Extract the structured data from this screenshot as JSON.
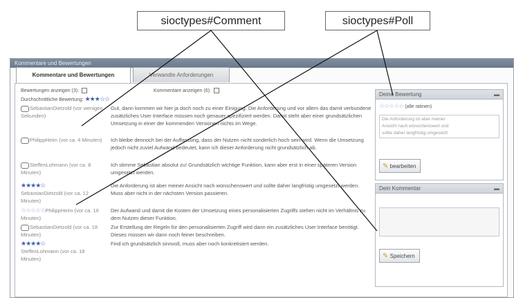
{
  "callouts": {
    "comment": "sioctypes#Comment",
    "poll": "sioctypes#Poll"
  },
  "window": {
    "title": "Kommentare und Bewertungen",
    "tabs": [
      {
        "label": "Kommentare und Bewertungen"
      },
      {
        "label": "Verwandte Anforderungen"
      }
    ]
  },
  "filters": {
    "show_ratings": "Bewertungen anzeigen (3):",
    "average_rating": "Durchschnittliche Bewertung:",
    "show_comments": "Kommentare anzeigen (6):"
  },
  "entries": [
    {
      "author": "SebastianDietzold",
      "time": "(vor wenigen Sekunden)",
      "text": "Gut, dann kommen wir hier ja doch noch zu einer Einigung. Die Anforderung und vor allem das damit verbundene zusätzliches User Interface müssen noch genauer spezifiziert werden. Damit steht aber einer grundsätzlichen Umsetzung in einer der kommenden Versionen nichts im Wege."
    },
    {
      "author": "PhilippHeim",
      "time": "(vor ca. 4 Minuten)",
      "text": "Ich bleibe dennoch bei der Auffassung, dass der Nutzen nicht sonderlich hoch sein wird. Wenn die Umsetzung jedoch nicht zuviel Aufwand bedeutet, kann ich dieser Anforderung nicht grundsätzlich ab."
    },
    {
      "author": "SteffenLohmann",
      "time": "(vor ca. 8 Minuten)",
      "text": "Ich stimme Sebastian absolut zu! Grundsätzlich wichtige Funktion, kann aber erst in einer späteren Version umgesetzt werden."
    },
    {
      "author": "SebastianDietzold",
      "time": "(vor ca. 12 Minuten)",
      "text": "Die Anforderung ist aber meiner Ansicht nach wünschenswert und sollte daher langfristig umgesetzt werden. Muss aber nicht in der nächsten Version passieren."
    },
    {
      "author": "PhilippHeim",
      "time": "(vor ca. 16 Minuten)",
      "text": "Der Aufwand und damit die Kosten der Umsetzung eines personalisierten Zugriffs stehen nicht im Verhältnis zu dem Nutzen dieser Funktion."
    },
    {
      "author": "SebastianDietzold",
      "time": "(vor ca. 18 Minuten)",
      "text": "Zur Erstellung der Regeln für den personalisierten Zugriff wird dann ein zusätzliches User Interface benötigt. Dieses müssen wir dann noch feiner beschreiben."
    },
    {
      "author": "SteffenLohmann",
      "time": "(vor ca. 18 Minuten)",
      "text": "Find ich grundsätzlich sinnvoll, muss aber noch konkretisiert werden."
    }
  ],
  "rating_box": {
    "title": "Deine Bewertung",
    "hint": "(alle ratinen)",
    "options": [
      "Die Anforderung ist aber meiner",
      "Ansicht nach wünschenswert und",
      "sollte daher langfristig umgesetzt"
    ],
    "edit_button": "bearbeiten"
  },
  "comment_box": {
    "title": "Dein Kommentar",
    "save_button": "Speichern"
  }
}
